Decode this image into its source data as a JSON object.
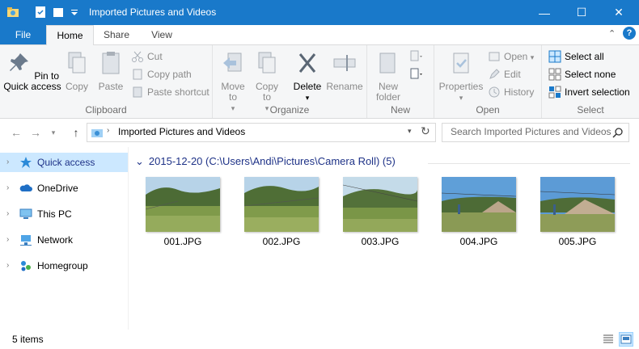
{
  "window": {
    "title": "Imported Pictures and Videos",
    "controls": {
      "minimize": "—",
      "maximize": "☐",
      "close": "✕"
    }
  },
  "tabs": [
    "File",
    "Home",
    "Share",
    "View"
  ],
  "ribbon": {
    "clipboard": {
      "label": "Clipboard",
      "pin": "Pin to Quick access",
      "copy": "Copy",
      "paste": "Paste",
      "cut": "Cut",
      "copy_path": "Copy path",
      "paste_shortcut": "Paste shortcut"
    },
    "organize": {
      "label": "Organize",
      "move_to": "Move to",
      "copy_to": "Copy to",
      "delete": "Delete",
      "rename": "Rename"
    },
    "new": {
      "label": "New",
      "new_folder": "New folder"
    },
    "open": {
      "label": "Open",
      "properties": "Properties",
      "open": "Open",
      "edit": "Edit",
      "history": "History"
    },
    "select": {
      "label": "Select",
      "select_all": "Select all",
      "select_none": "Select none",
      "invert": "Invert selection"
    }
  },
  "address": {
    "path": "Imported Pictures and Videos",
    "search_placeholder": "Search Imported Pictures and Videos"
  },
  "nav": [
    {
      "label": "Quick access",
      "icon": "star-icon",
      "selected": true
    },
    {
      "label": "OneDrive",
      "icon": "cloud-icon"
    },
    {
      "label": "This PC",
      "icon": "monitor-icon"
    },
    {
      "label": "Network",
      "icon": "network-icon"
    },
    {
      "label": "Homegroup",
      "icon": "homegroup-icon"
    }
  ],
  "group": {
    "header": "2015-12-20 (C:\\Users\\Andi\\Pictures\\Camera Roll) (5)"
  },
  "files": [
    {
      "name": "001.JPG"
    },
    {
      "name": "002.JPG"
    },
    {
      "name": "003.JPG"
    },
    {
      "name": "004.JPG"
    },
    {
      "name": "005.JPG"
    }
  ],
  "status": {
    "items": "5 items"
  },
  "colors": {
    "titlebar": "#1979ca",
    "selection": "#cce8ff",
    "group_header": "#1e3287"
  }
}
